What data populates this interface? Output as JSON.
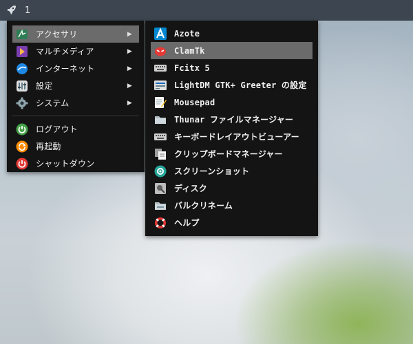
{
  "taskbar": {
    "workspace": "1"
  },
  "main_menu": {
    "categories": [
      {
        "label": "アクセサリ",
        "icon": "accessories-icon",
        "has_submenu": true,
        "active": true
      },
      {
        "label": "マルチメディア",
        "icon": "multimedia-icon",
        "has_submenu": true
      },
      {
        "label": "インターネット",
        "icon": "internet-icon",
        "has_submenu": true
      },
      {
        "label": "設定",
        "icon": "settings-icon",
        "has_submenu": true
      },
      {
        "label": "システム",
        "icon": "system-icon",
        "has_submenu": true
      }
    ],
    "session": [
      {
        "label": "ログアウト",
        "icon": "logout-icon"
      },
      {
        "label": "再起動",
        "icon": "restart-icon"
      },
      {
        "label": "シャットダウン",
        "icon": "shutdown-icon"
      }
    ],
    "submenu_arrow": "▶"
  },
  "accessories_submenu": {
    "items": [
      {
        "label": "Azote",
        "icon": "azote-icon"
      },
      {
        "label": "ClamTk",
        "icon": "clamtk-icon",
        "highlighted": true
      },
      {
        "label": "Fcitx 5",
        "icon": "keyboard-icon"
      },
      {
        "label": "LightDM GTK+ Greeter の設定",
        "icon": "lightdm-icon"
      },
      {
        "label": "Mousepad",
        "icon": "mousepad-icon"
      },
      {
        "label": "Thunar ファイルマネージャー",
        "icon": "thunar-icon"
      },
      {
        "label": "キーボードレイアウトビューアー",
        "icon": "keyboard-layout-icon"
      },
      {
        "label": "クリップボードマネージャー",
        "icon": "clipboard-icon"
      },
      {
        "label": "スクリーンショット",
        "icon": "screenshot-icon"
      },
      {
        "label": "ディスク",
        "icon": "disks-icon"
      },
      {
        "label": "バルクリネーム",
        "icon": "bulk-rename-icon"
      },
      {
        "label": "ヘルプ",
        "icon": "help-icon"
      }
    ]
  },
  "colors": {
    "menu_bg": "#141414",
    "highlight_bg": "#6b6b6b",
    "taskbar_bg": "#3d4650"
  }
}
